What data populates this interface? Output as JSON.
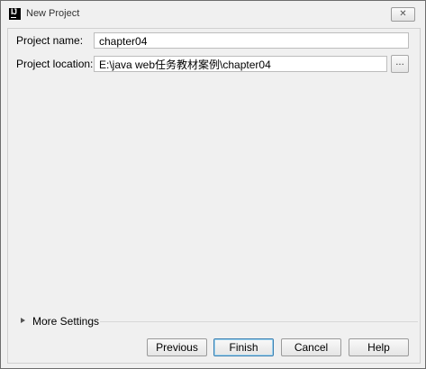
{
  "window": {
    "title": "New Project",
    "close_glyph": "✕"
  },
  "form": {
    "project_name_label": "Project name:",
    "project_name_value": "chapter04",
    "project_location_label": "Project location:",
    "project_location_value": "E:\\java web任务教材案例\\chapter04",
    "browse_label": "..."
  },
  "more_settings": {
    "label": "More Settings"
  },
  "buttons": {
    "previous": "Previous",
    "finish": "Finish",
    "cancel": "Cancel",
    "help": "Help"
  },
  "icons": {
    "app": "intellij-icon",
    "close": "close-icon",
    "expand": "expand-triangle-icon"
  }
}
